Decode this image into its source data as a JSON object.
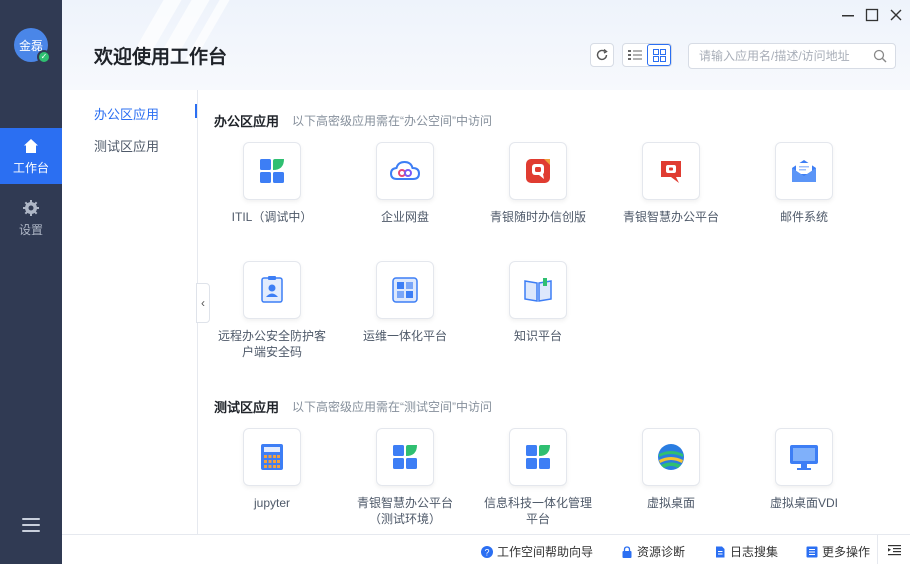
{
  "user": {
    "avatar_text": "金磊"
  },
  "rail": {
    "items": [
      {
        "label": "工作台",
        "icon": "home-icon",
        "active": true
      },
      {
        "label": "设置",
        "icon": "gear-icon",
        "active": false
      }
    ]
  },
  "header": {
    "title": "欢迎使用工作台",
    "search_placeholder": "请输入应用名/描述/访问地址"
  },
  "categories": [
    {
      "label": "办公区应用",
      "active": true
    },
    {
      "label": "测试区应用",
      "active": false
    }
  ],
  "sections": [
    {
      "title": "办公区应用",
      "note": "以下高密级应用需在“办公空间”中访问",
      "apps": [
        {
          "name": "ITIL（调试中）",
          "icon": "windows-tiles-icon"
        },
        {
          "name": "企业网盘",
          "icon": "cloud-drive-icon"
        },
        {
          "name": "青银随时办信创版",
          "icon": "red-chat-icon"
        },
        {
          "name": "青银智慧办公平台",
          "icon": "red-chat-icon"
        },
        {
          "name": "邮件系统",
          "icon": "mail-icon"
        },
        {
          "name": "远程办公安全防护客户端安全码",
          "icon": "id-card-icon"
        },
        {
          "name": "运维一体化平台",
          "icon": "ops-panel-icon"
        },
        {
          "name": "知识平台",
          "icon": "book-icon"
        }
      ]
    },
    {
      "title": "测试区应用",
      "note": "以下高密级应用需在“测试空间”中访问",
      "apps": [
        {
          "name": "jupyter",
          "icon": "calculator-icon"
        },
        {
          "name": "青银智慧办公平台（测试环境）",
          "icon": "windows-tiles-icon"
        },
        {
          "name": "信息科技一体化管理平台",
          "icon": "windows-tiles-icon"
        },
        {
          "name": "虚拟桌面",
          "icon": "globe-icon"
        },
        {
          "name": "虚拟桌面VDI",
          "icon": "monitor-icon"
        }
      ]
    }
  ],
  "footer": {
    "items": [
      {
        "label": "工作空间帮助向导",
        "icon": "help-icon"
      },
      {
        "label": "资源诊断",
        "icon": "lock-icon"
      },
      {
        "label": "日志搜集",
        "icon": "document-icon"
      },
      {
        "label": "更多操作",
        "icon": "list-icon"
      }
    ]
  },
  "colors": {
    "accent": "#2b6ff2",
    "rail": "#303a53"
  }
}
